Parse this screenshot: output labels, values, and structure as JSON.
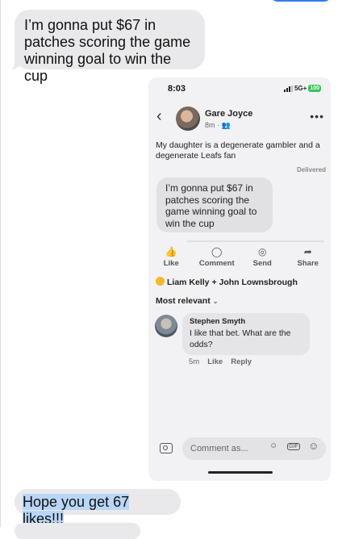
{
  "messages": {
    "incoming_1": "I’m gonna put $67 in\npatches scoring the game\nwinning goal to win the cup",
    "outgoing_reply": "Hope you get 67 likes!!!"
  },
  "screenshot": {
    "status_bar": {
      "time": "8:03",
      "network": "5G+",
      "battery": "100"
    },
    "post": {
      "author": "Gare Joyce",
      "meta": "8m · 👥",
      "text": "My daughter is a degenerate gambler and a degenerate Leafs fan",
      "status": "Delivered",
      "shared_message": "I’m gonna put $67 in patches scoring the game winning goal to win the cup"
    },
    "actions": [
      {
        "label": "Like",
        "icon": "thumbs-up-icon",
        "glyph": "👍"
      },
      {
        "label": "Comment",
        "icon": "comment-icon",
        "glyph": "◯"
      },
      {
        "label": "Send",
        "icon": "messenger-icon",
        "glyph": "◎"
      },
      {
        "label": "Share",
        "icon": "share-icon",
        "glyph": "➦"
      }
    ],
    "reactions": {
      "names": "Liam Kelly + John Lownsbrough"
    },
    "filter": {
      "label": "Most relevant"
    },
    "comment": {
      "author": "Stephen Smyth",
      "text": "I like that bet. What are the odds?",
      "time": "5m",
      "like": "Like",
      "reply": "Reply"
    },
    "composer": {
      "placeholder": "Comment as..."
    }
  }
}
